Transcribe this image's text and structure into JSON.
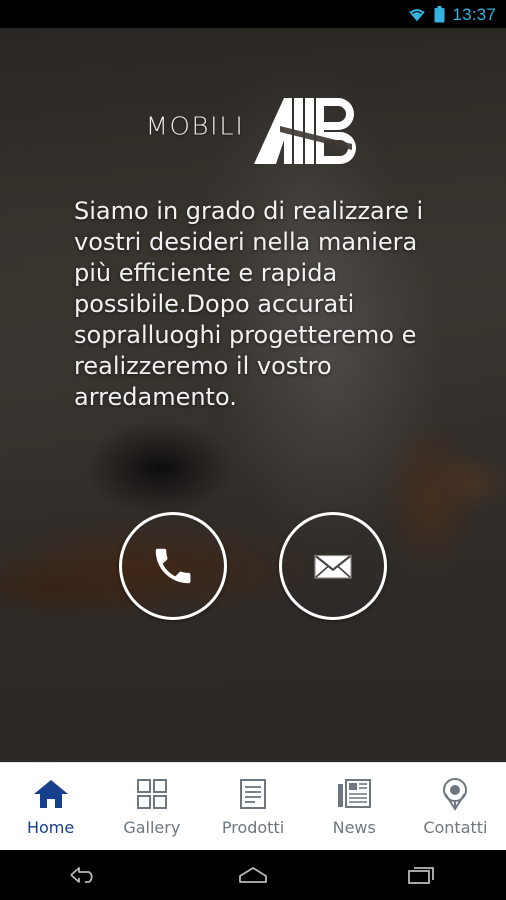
{
  "status_bar": {
    "time": "13:37",
    "wifi_icon": "wifi-icon",
    "battery_icon": "battery-icon",
    "accent_color": "#34b3e0",
    "background_color": "#000000"
  },
  "brand": {
    "word_mark": "MOBILI",
    "monogram": "AB",
    "monogram_icon": "ab-monogram-logo"
  },
  "hero": {
    "paragraph": "Siamo in grado di realizzare i vostri desideri nella maniera più efficiente e rapida possibile.Dopo accurati sopralluoghi progetteremo e realizzeremo il vostro arredamento.",
    "text_color": "#f2f2f2"
  },
  "contact_actions": [
    {
      "name": "call",
      "icon": "phone-icon"
    },
    {
      "name": "email",
      "icon": "envelope-icon"
    }
  ],
  "bottom_nav": {
    "active_color": "#163f8c",
    "inactive_color": "#6e7680",
    "items": [
      {
        "label": "Home",
        "icon": "home-icon",
        "active": true
      },
      {
        "label": "Gallery",
        "icon": "grid-icon",
        "active": false
      },
      {
        "label": "Prodotti",
        "icon": "list-doc-icon",
        "active": false
      },
      {
        "label": "News",
        "icon": "newspaper-icon",
        "active": false
      },
      {
        "label": "Contatti",
        "icon": "map-pin-icon",
        "active": false
      }
    ]
  },
  "system_nav": {
    "back": "back-button",
    "home": "home-button",
    "recents": "recents-button"
  }
}
